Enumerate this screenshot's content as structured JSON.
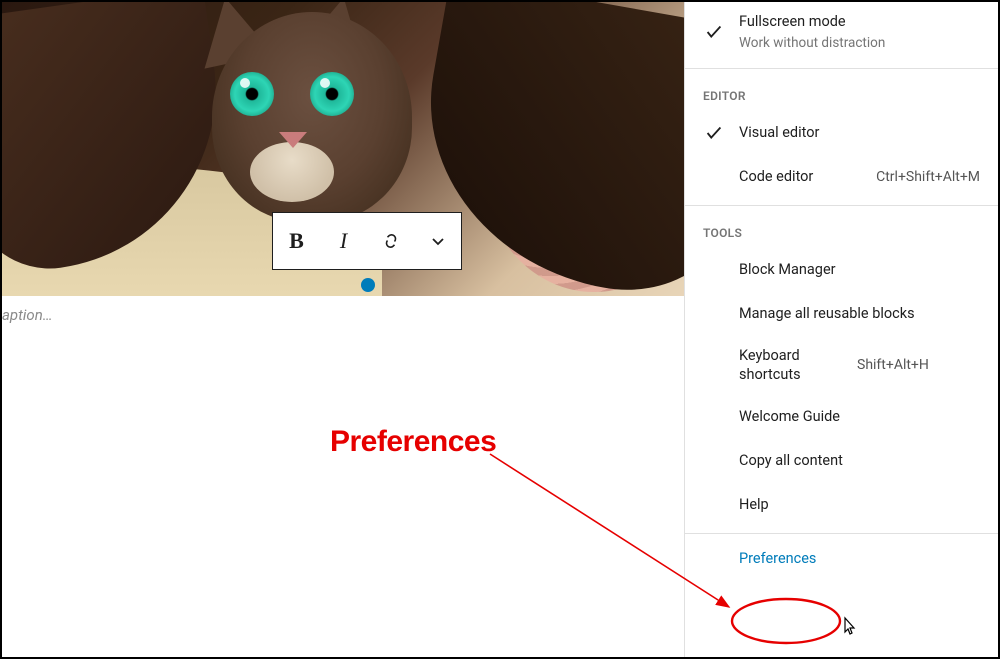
{
  "editor": {
    "caption_placeholder": "aption…",
    "toolbar": {
      "bold": "B",
      "italic": "I"
    }
  },
  "menu": {
    "view": {
      "fullscreen": {
        "label": "Fullscreen mode",
        "sub": "Work without distraction"
      }
    },
    "editor_heading": "EDITOR",
    "editor": {
      "visual": {
        "label": "Visual editor"
      },
      "code": {
        "label": "Code editor",
        "shortcut": "Ctrl+Shift+Alt+M"
      }
    },
    "tools_heading": "TOOLS",
    "tools": {
      "block_manager": "Block Manager",
      "manage_reusable": "Manage all reusable blocks",
      "keyboard_shortcuts": {
        "label": "Keyboard shortcuts",
        "shortcut": "Shift+Alt+H"
      },
      "welcome_guide": "Welcome Guide",
      "copy_all": "Copy all content",
      "help": "Help"
    },
    "preferences": "Preferences"
  },
  "annotation": {
    "label": "Preferences"
  }
}
